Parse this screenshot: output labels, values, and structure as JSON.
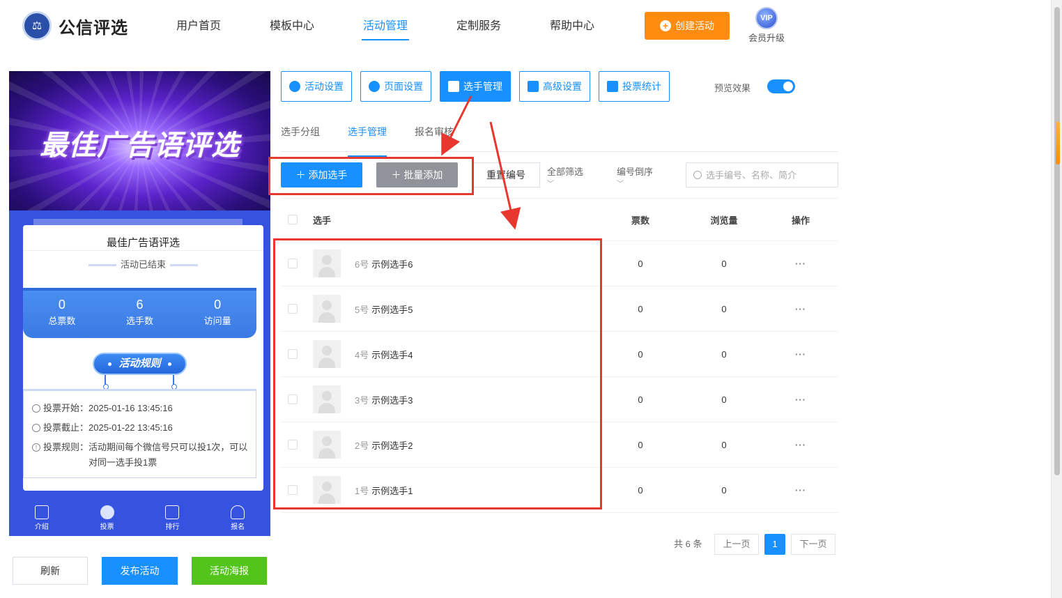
{
  "header": {
    "logo_text": "公信评选",
    "logo_glyph": "⚖",
    "nav": [
      "用户首页",
      "模板中心",
      "活动管理",
      "定制服务",
      "帮助中心"
    ],
    "active_nav": 2,
    "create_label": "创建活动",
    "vip_badge": "VIP",
    "vip_label": "会员升级"
  },
  "preview": {
    "banner_title": "最佳广告语评选",
    "card_title": "最佳广告语评选",
    "status": "活动已结束",
    "stats": [
      {
        "value": "0",
        "label": "总票数"
      },
      {
        "value": "6",
        "label": "选手数"
      },
      {
        "value": "0",
        "label": "访问量"
      }
    ],
    "rules_title": "活动规则",
    "rules": [
      {
        "key": "投票开始：",
        "value": "2025-01-16 13:45:16"
      },
      {
        "key": "投票截止：",
        "value": "2025-01-22 13:45:16"
      },
      {
        "key": "投票规则：",
        "value": "活动期间每个微信号只可以投1次，可以对同一选手投1票"
      }
    ],
    "bottom_nav": [
      "介绍",
      "投票",
      "排行",
      "报名"
    ]
  },
  "actions": {
    "refresh": "刷新",
    "publish": "发布活动",
    "poster": "活动海报"
  },
  "tool_tabs": [
    "活动设置",
    "页面设置",
    "选手管理",
    "高级设置",
    "投票统计"
  ],
  "preview_toggle_label": "预览效果",
  "sub_tabs": [
    "选手分组",
    "选手管理",
    "报名审核"
  ],
  "toolbar": {
    "add_player": "添加选手",
    "batch_add": "批量添加",
    "renumber": "重置编号",
    "filter_all": "全部筛选",
    "sort_desc": "编号倒序",
    "search_placeholder": "选手编号、名称、简介"
  },
  "table": {
    "headers": {
      "player": "选手",
      "votes": "票数",
      "views": "浏览量",
      "ops": "操作"
    },
    "rows": [
      {
        "num": "6号",
        "name": "示例选手6",
        "votes": "0",
        "views": "0"
      },
      {
        "num": "5号",
        "name": "示例选手5",
        "votes": "0",
        "views": "0"
      },
      {
        "num": "4号",
        "name": "示例选手4",
        "votes": "0",
        "views": "0"
      },
      {
        "num": "3号",
        "name": "示例选手3",
        "votes": "0",
        "views": "0"
      },
      {
        "num": "2号",
        "name": "示例选手2",
        "votes": "0",
        "views": "0"
      },
      {
        "num": "1号",
        "name": "示例选手1",
        "votes": "0",
        "views": "0"
      }
    ]
  },
  "pager": {
    "total": "共 6 条",
    "prev": "上一页",
    "current": "1",
    "next": "下一页"
  },
  "colors": {
    "primary": "#1890ff",
    "create": "#ff8c0f",
    "poster": "#52c41a",
    "annotation": "#e8372e"
  }
}
